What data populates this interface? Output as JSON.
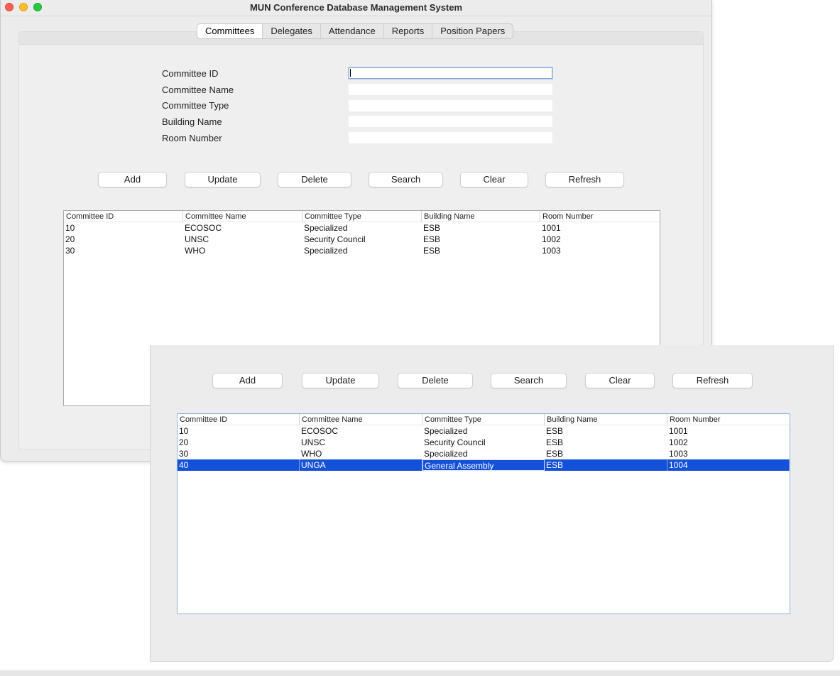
{
  "window": {
    "title": "MUN Conference Database Management System"
  },
  "tabs": [
    "Committees",
    "Delegates",
    "Attendance",
    "Reports",
    "Position Papers"
  ],
  "form": {
    "labels": [
      "Committee ID",
      "Committee Name",
      "Committee Type",
      "Building Name",
      "Room Number"
    ],
    "values": [
      "",
      "",
      "",
      "",
      ""
    ]
  },
  "buttons": [
    "Add",
    "Update",
    "Delete",
    "Search",
    "Clear",
    "Refresh"
  ],
  "table": {
    "columns": [
      "Committee ID",
      "Committee Name",
      "Committee Type",
      "Building Name",
      "Room Number"
    ],
    "rows": [
      [
        "10",
        "ECOSOC",
        "Specialized",
        "ESB",
        "1001"
      ],
      [
        "20",
        "UNSC",
        "Security Council",
        "ESB",
        "1002"
      ],
      [
        "30",
        "WHO",
        "Specialized",
        "ESB",
        "1003"
      ]
    ]
  },
  "overlay_table": {
    "columns": [
      "Committee ID",
      "Committee Name",
      "Committee Type",
      "Building Name",
      "Room Number"
    ],
    "rows": [
      [
        "10",
        "ECOSOC",
        "Specialized",
        "ESB",
        "1001"
      ],
      [
        "20",
        "UNSC",
        "Security Council",
        "ESB",
        "1002"
      ],
      [
        "30",
        "WHO",
        "Specialized",
        "ESB",
        "1003"
      ],
      [
        "40",
        "UNGA",
        "General Assembly",
        "ESB",
        "1004"
      ]
    ]
  },
  "colors": {
    "selection": "#1551d8",
    "focus_ring": "#8aa9d6"
  }
}
